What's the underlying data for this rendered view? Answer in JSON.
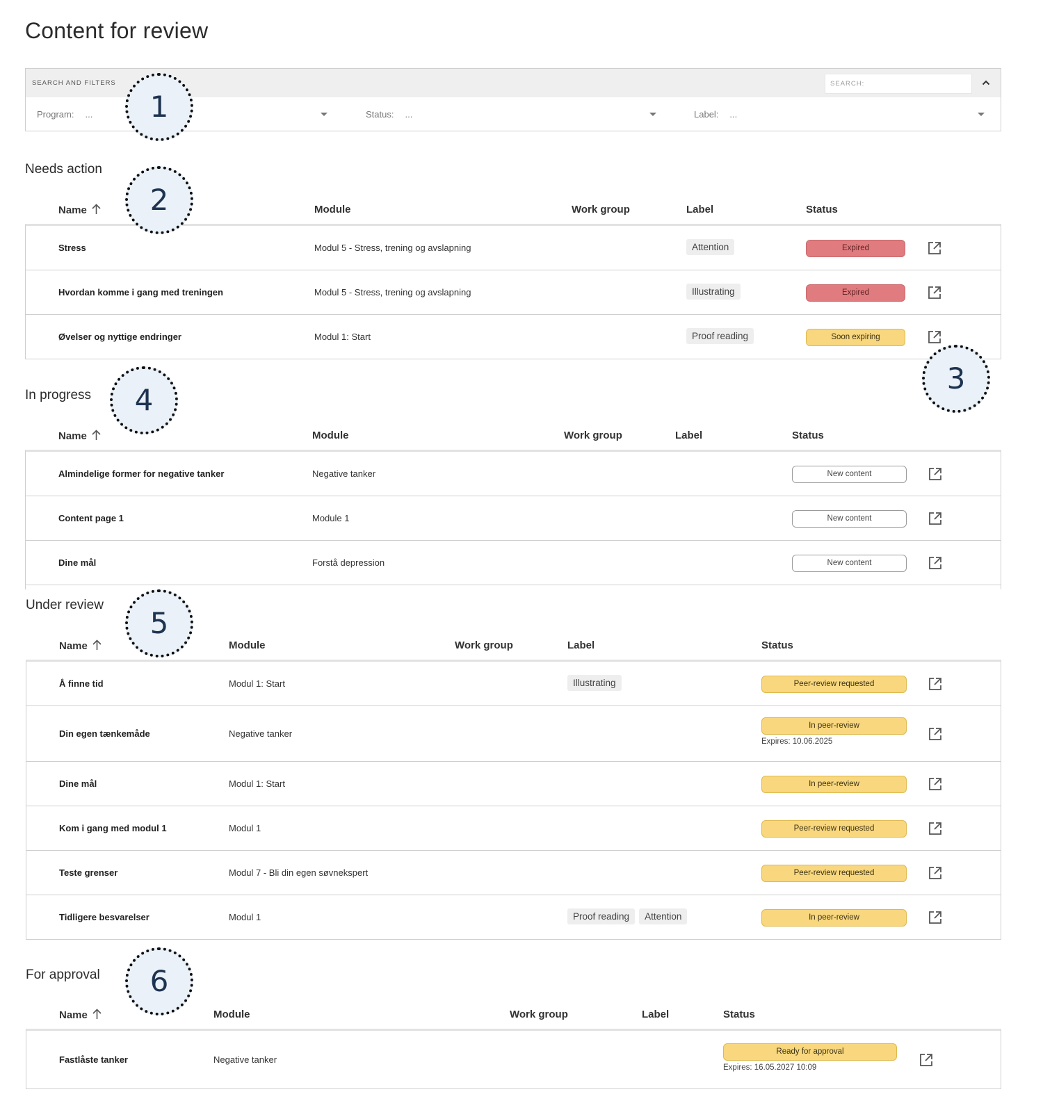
{
  "page": {
    "title": "Content for review"
  },
  "filters": {
    "heading": "SEARCH AND FILTERS",
    "search_placeholder": "SEARCH:",
    "program": {
      "label": "Program:",
      "value": "..."
    },
    "status": {
      "label": "Status:",
      "value": "..."
    },
    "label": {
      "label": "Label:",
      "value": "..."
    }
  },
  "columns": {
    "name": "Name",
    "module": "Module",
    "work_group": "Work group",
    "label": "Label",
    "status": "Status"
  },
  "needs_action": {
    "title": "Needs action",
    "rows": [
      {
        "name": "Stress",
        "module": "Modul 5 - Stress, trening og avslapning",
        "labels": [
          "Attention"
        ],
        "status": "Expired"
      },
      {
        "name": "Hvordan komme i gang med treningen",
        "module": "Modul 5 - Stress, trening og avslapning",
        "labels": [
          "Illustrating"
        ],
        "status": "Expired"
      },
      {
        "name": "Øvelser og nyttige endringer",
        "module": "Modul 1: Start",
        "labels": [
          "Proof reading"
        ],
        "status": "Soon expiring"
      }
    ]
  },
  "in_progress": {
    "title": "In progress",
    "rows": [
      {
        "name": "Almindelige former for negative tanker",
        "module": "Negative tanker",
        "status": "New content"
      },
      {
        "name": "Content page 1",
        "module": "Module 1",
        "status": "New content"
      },
      {
        "name": "Dine mål",
        "module": "Forstå depression",
        "status": "New content"
      }
    ]
  },
  "under_review": {
    "title": "Under review",
    "rows": [
      {
        "name": "Å finne tid",
        "module": "Modul 1: Start",
        "labels": [
          "Illustrating"
        ],
        "status": "Peer-review requested",
        "expires": ""
      },
      {
        "name": "Din egen tænkemåde",
        "module": "Negative tanker",
        "labels": [],
        "status": "In peer-review",
        "expires": "Expires: 10.06.2025"
      },
      {
        "name": "Dine mål",
        "module": "Modul 1: Start",
        "labels": [],
        "status": "In peer-review",
        "expires": ""
      },
      {
        "name": "Kom i gang med modul 1",
        "module": "Modul 1",
        "labels": [],
        "status": "Peer-review requested",
        "expires": ""
      },
      {
        "name": "Teste grenser",
        "module": "Modul 7 - Bli din egen søvnekspert",
        "labels": [],
        "status": "Peer-review requested",
        "expires": ""
      },
      {
        "name": "Tidligere besvarelser",
        "module": "Modul 1",
        "labels": [
          "Proof reading",
          "Attention"
        ],
        "status": "In peer-review",
        "expires": ""
      }
    ]
  },
  "for_approval": {
    "title": "For approval",
    "rows": [
      {
        "name": "Fastlåste tanker",
        "module": "Negative tanker",
        "status": "Ready for approval",
        "expires": "Expires: 16.05.2027 10:09"
      }
    ]
  },
  "markers": [
    "1",
    "2",
    "3",
    "4",
    "5",
    "6"
  ],
  "colors": {
    "expired": "#e07c7f",
    "warning": "#f8d77e",
    "panel": "#efefef",
    "border": "#cfcfcf"
  },
  "icons": {
    "sort": "arrow-up-icon",
    "open": "external-link-icon",
    "collapse": "chevron-up-icon",
    "dropdown": "caret-down-icon"
  }
}
